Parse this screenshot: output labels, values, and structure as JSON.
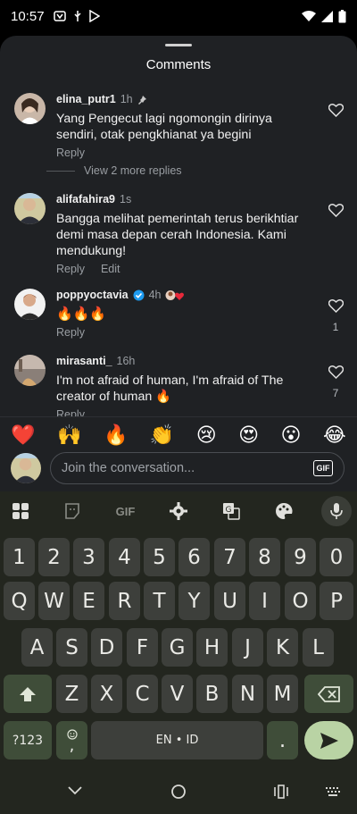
{
  "status": {
    "time": "10:57"
  },
  "sheet": {
    "title": "Comments"
  },
  "comments": [
    {
      "user": "elina_putr1",
      "time": "1h",
      "text": "Yang Pengecut lagi ngomongin dirinya sendiri, otak pengkhianat ya begini",
      "reply": "Reply",
      "likes": ""
    },
    {
      "user": "alifafahira9",
      "time": "1s",
      "text": "Bangga melihat pemerintah terus berikhtiar demi masa depan cerah Indonesia. Kami mendukung!",
      "reply": "Reply",
      "edit": "Edit",
      "likes": ""
    },
    {
      "user": "poppyoctavia",
      "time": "4h",
      "text": "🔥🔥🔥",
      "reply": "Reply",
      "likes": "1"
    },
    {
      "user": "mirasanti_",
      "time": "16h",
      "text": "I'm not afraid of human, I'm afraid of The creator of human 🔥",
      "reply": "Reply",
      "likes": "7"
    }
  ],
  "view_replies": "View 2 more replies",
  "emojis": [
    "❤️",
    "🙌",
    "🔥",
    "👏",
    "😢",
    "😍",
    "😮",
    "😂"
  ],
  "composer": {
    "placeholder": "Join the conversation...",
    "gif_label": "GIF"
  },
  "keyboard": {
    "toolbar_gif": "GIF",
    "number_row": [
      "1",
      "2",
      "3",
      "4",
      "5",
      "6",
      "7",
      "8",
      "9",
      "0"
    ],
    "row1": [
      "Q",
      "W",
      "E",
      "R",
      "T",
      "Y",
      "U",
      "I",
      "O",
      "P"
    ],
    "row2": [
      "A",
      "S",
      "D",
      "F",
      "G",
      "H",
      "J",
      "K",
      "L"
    ],
    "row3": [
      "Z",
      "X",
      "C",
      "V",
      "B",
      "N",
      "M"
    ],
    "symbols_key": "?123",
    "comma_key": ",",
    "space_label": "EN • ID",
    "period_key": "."
  },
  "colors": {
    "sheet_bg": "#1f2124",
    "keyboard_bg": "#23261f",
    "key_bg": "#3d3f3b",
    "enter_key": "#b9d3a4",
    "verified": "#1d9bf0"
  }
}
